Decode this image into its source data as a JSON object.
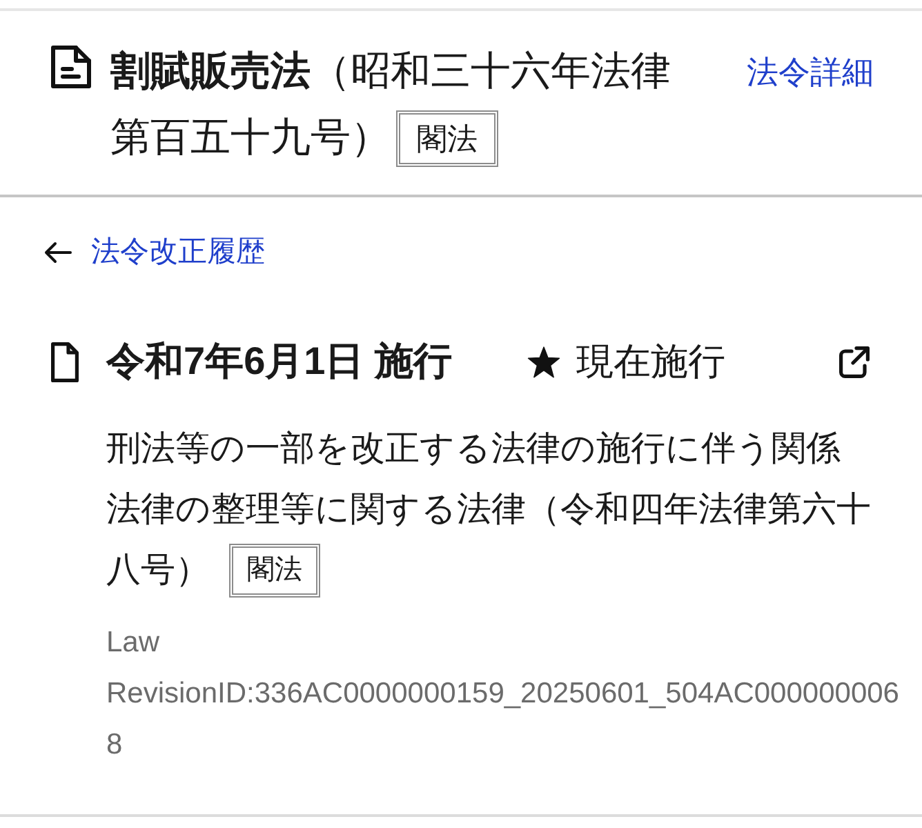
{
  "law": {
    "title_lines": [
      "**割賦販売法**（昭和三十六年法律",
      "第百五十九号）"
    ],
    "law_type": "閣法",
    "details_link": "法令詳細"
  },
  "back_link": "法令改正履歴",
  "revision": {
    "effective_date": "令和7年6月1日 施行",
    "status": "現在施行",
    "amending_law_lines": [
      "刑法等の一部を改正する法律の施行に伴う関係",
      "法律の整理等に関する法律（令和四年法律第六十",
      "八号）"
    ],
    "amending_law_type": "閣法",
    "revision_id": "Law RevisionID:336AC0000000159_20250601_504AC0000000068"
  }
}
